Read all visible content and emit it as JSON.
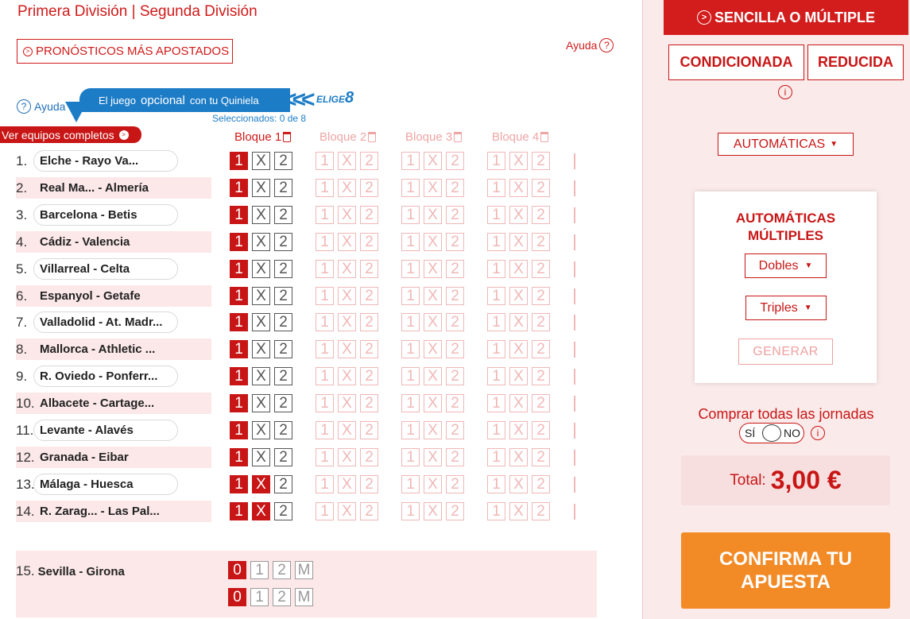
{
  "header": {
    "league_primera": "Primera División",
    "league_separator": "|",
    "league_segunda": "Segunda División"
  },
  "left": {
    "pronosticos_label": "PRONÓSTICOS MÁS APOSTADOS",
    "ayuda_top": "Ayuda",
    "ayuda_left": "Ayuda",
    "banner_prefix": "El juego",
    "banner_highlight": "opcional",
    "banner_suffix": "con tu Quiniela",
    "elige_text": "ELIGE",
    "elige_num": "8",
    "seleccionados": "Seleccionados: 0 de 8",
    "ver_equipos": "Ver equipos completos",
    "bloques": [
      "Bloque 1",
      "Bloque 2",
      "Bloque 3",
      "Bloque 4"
    ],
    "options": [
      "1",
      "X",
      "2"
    ],
    "matches": [
      {
        "num": "1.",
        "match": "Elche - Rayo Va...",
        "selected": [
          "1"
        ]
      },
      {
        "num": "2.",
        "match": "Real Ma... - Almería",
        "selected": [
          "1"
        ]
      },
      {
        "num": "3.",
        "match": "Barcelona - Betis",
        "selected": [
          "1"
        ]
      },
      {
        "num": "4.",
        "match": "Cádiz - Valencia",
        "selected": [
          "1"
        ]
      },
      {
        "num": "5.",
        "match": "Villarreal - Celta",
        "selected": [
          "1"
        ]
      },
      {
        "num": "6.",
        "match": "Espanyol - Getafe",
        "selected": [
          "1"
        ]
      },
      {
        "num": "7.",
        "match": "Valladolid - At. Madr...",
        "selected": [
          "1"
        ]
      },
      {
        "num": "8.",
        "match": "Mallorca - Athletic ...",
        "selected": [
          "1"
        ]
      },
      {
        "num": "9.",
        "match": "R. Oviedo - Ponferr...",
        "selected": [
          "1"
        ]
      },
      {
        "num": "10.",
        "match": "Albacete - Cartage...",
        "selected": [
          "1"
        ]
      },
      {
        "num": "11.",
        "match": "Levante - Alavés",
        "selected": [
          "1"
        ]
      },
      {
        "num": "12.",
        "match": "Granada - Eibar",
        "selected": [
          "1"
        ]
      },
      {
        "num": "13.",
        "match": "Málaga - Huesca",
        "selected": [
          "1",
          "X"
        ]
      },
      {
        "num": "14.",
        "match": "R. Zarag... - Las Pal...",
        "selected": [
          "1",
          "X"
        ]
      }
    ],
    "pleno": {
      "num": "15.",
      "match": "Sevilla - Girona",
      "options": [
        "0",
        "1",
        "2",
        "M"
      ],
      "selected_home": "0",
      "selected_away": "0"
    }
  },
  "right": {
    "tab_top": "SENCILLA O MÚLTIPLE",
    "tab_condicionada": "CONDICIONADA",
    "tab_reducida": "REDUCIDA",
    "info_icon": "i",
    "automaticas_btn": "AUTOMÁTICAS",
    "card_title_line1": "AUTOMÁTICAS",
    "card_title_line2": "MÚLTIPLES",
    "dobles": "Dobles",
    "triples": "Triples",
    "generar": "GENERAR",
    "comprar_text": "Comprar todas las jornadas",
    "toggle_si": "SÍ",
    "toggle_no": "NO",
    "total_label": "Total:",
    "total_amount": "3,00 €",
    "confirm_label": "CONFIRMA TU APUESTA"
  },
  "colors": {
    "brand_red": "#d11a1a",
    "selected_red": "#c81616",
    "info_blue": "#1c7cc6",
    "confirm_orange": "#f28a26",
    "panel_pink": "#fbeaea"
  },
  "icons": {
    "pronosticos": "circle-arrow-icon",
    "ayuda": "question-circle-icon",
    "bloque_delete": "trash-icon",
    "ver_equipos": "circle-arrow-icon",
    "tab_top": "circle-arrow-icon",
    "info": "info-circle-icon",
    "dropdown": "caret-down-icon"
  }
}
